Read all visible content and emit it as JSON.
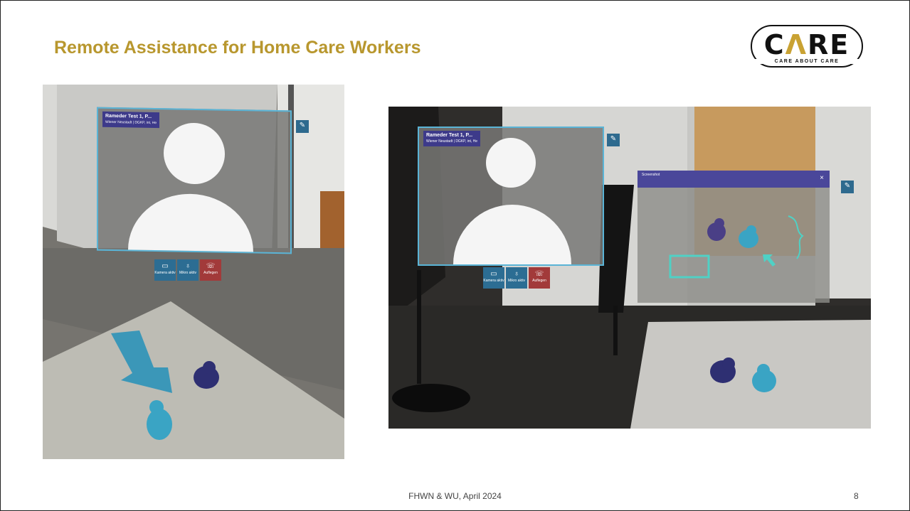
{
  "title": "Remote Assistance for Home Care Workers",
  "logo": {
    "text": "CARE",
    "tagline": "CARE ABOUT CARE"
  },
  "left_photo": {
    "call_name": "Rameder Test 1, P...",
    "call_subtitle": "Wiener Neustadt | DGKP, int, He",
    "pin_label": "Pin",
    "controls": [
      {
        "label": "Kamera aktiv"
      },
      {
        "label": "Mikro aktiv"
      },
      {
        "label": "Auflegen"
      }
    ]
  },
  "right_photo": {
    "call_name": "Rameder Test 1, P...",
    "call_subtitle": "Wiener Neustadt | DGKP, int, He",
    "pin_label": "Pin",
    "snapshot_title": "Screenshot",
    "controls": [
      {
        "label": "Kamera aktiv"
      },
      {
        "label": "Mikro aktiv"
      },
      {
        "label": "Auflegen"
      }
    ]
  },
  "footer": "FHWN & WU, April 2024",
  "page_number": "8",
  "colors": {
    "title": "#b8972e",
    "frame": "#5ab4d6",
    "annotation": "#4fd1c5",
    "name_badge": "#3d3a8a"
  }
}
